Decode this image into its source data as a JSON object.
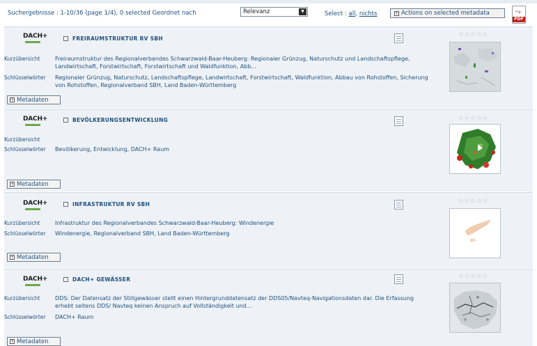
{
  "header": {
    "results_summary": "Suchergebnisse :  1-10/36  (page 1/4),  0 selected  Geordnet nach",
    "sort_selected": "Relevanz",
    "select_label": "Select : ",
    "select_all": "all",
    "select_sep": ", ",
    "select_none": "nichts",
    "actions_label": "Actions on selected metadata",
    "pdf_icon": "pdf-icon"
  },
  "labels": {
    "kurz": "Kurzübersicht",
    "schluessel": "Schlüsselwörter",
    "metadaten": "Metadaten"
  },
  "records": [
    {
      "logo": "DACH+",
      "title": "FREIRAUMSTRUKTUR RV SBH",
      "summary": "Freiraumstruktur des Regionalverbandes Schwarzwald-Baar-Heuberg: Regionaler Grünzug, Naturschutz und Landschaftspflege, Landwirtschaft, Forstwirtschaft, Forstwirtschaft und Waldfunktion, Abb...",
      "keywords": "Regionaler Grünzug, Naturschutz, Landschaftspflege, Landwirtschaft, Forstwirtschaft, Waldfunktion, Abbau von Rohstoffen, Sicherung von Rohstoffen, Regionalverband SBH, Land Baden-Württemberg",
      "stars": "☆☆☆☆☆"
    },
    {
      "logo": "DACH+",
      "title": "BEVÖLKERUNGSENTWICKLUNG",
      "summary": "",
      "keywords": "Bevölkerung, Entwicklung, DACH+ Raum",
      "stars": "☆☆☆☆☆"
    },
    {
      "logo": "DACH+",
      "title": "INFRASTRUKTUR RV SBH",
      "summary": "Infrastruktur des Regionalverbandes Schwarzwald-Baar-Heuberg: Windenergie",
      "keywords": "Windenergie, Regionalverband SBH, Land Baden-Württemberg",
      "stars": "☆☆☆☆☆"
    },
    {
      "logo": "DACH+",
      "title": "DACH+ GEWÄSSER",
      "summary": "DDS: Der Datensatz der Stillgewässer stellt einen Hintergrunddatensatz der DDS05/Navteq-Navigationsdaten dar. Die Erfassung erhebt seitens DDS/ Navteq keinen Anspruch auf Vollständigkeit und...",
      "keywords": "DACH+ Raum",
      "stars": "☆☆☆☆☆"
    }
  ]
}
